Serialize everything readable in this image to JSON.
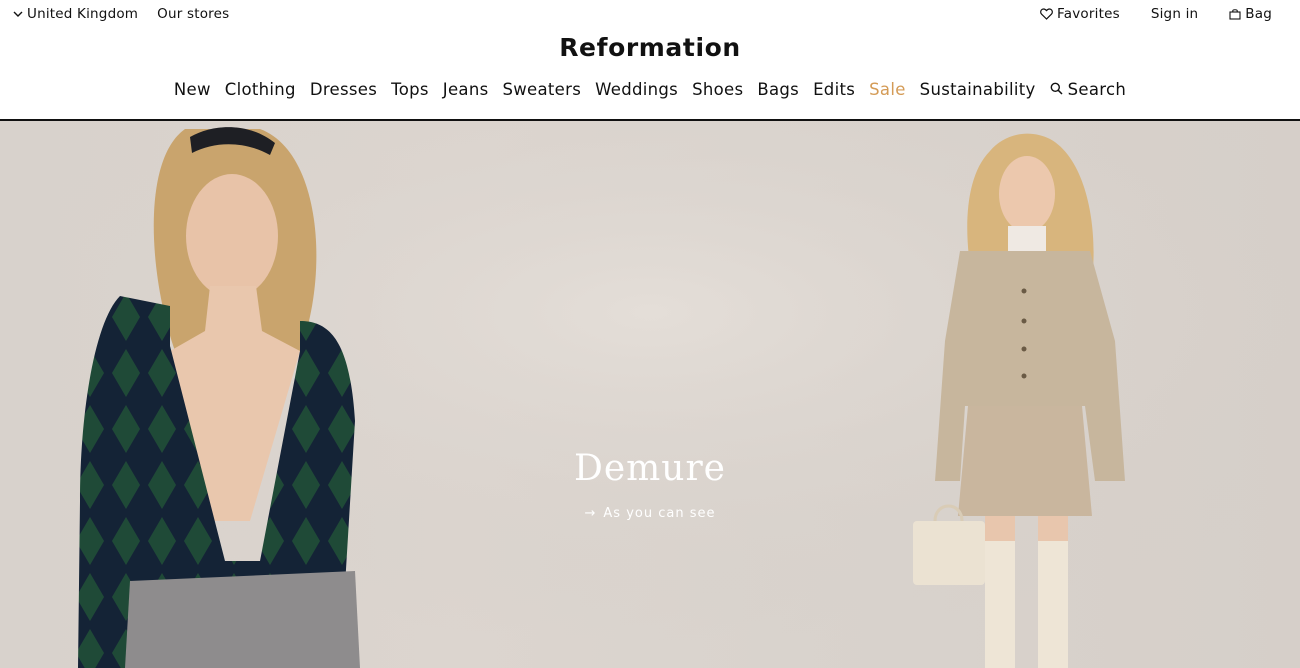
{
  "topbar": {
    "country_label": "United Kingdom",
    "stores_label": "Our stores",
    "favorites_label": "Favorites",
    "signin_label": "Sign in",
    "bag_label": "Bag"
  },
  "brand": {
    "logo_text": "Reformation"
  },
  "nav": {
    "items": [
      "New",
      "Clothing",
      "Dresses",
      "Tops",
      "Jeans",
      "Sweaters",
      "Weddings",
      "Shoes",
      "Bags",
      "Edits",
      "Sale",
      "Sustainability"
    ],
    "search_label": "Search"
  },
  "hero": {
    "headline": "Demure",
    "cta_label": "As you can see",
    "cta_arrow": "→"
  },
  "colors": {
    "sale_accent": "#d49b56",
    "hero_background": "#dad3cd",
    "text": "#111111"
  },
  "icons": {
    "country": "chevron-down-icon",
    "favorites": "heart-icon",
    "bag": "bag-icon",
    "search": "search-icon"
  }
}
